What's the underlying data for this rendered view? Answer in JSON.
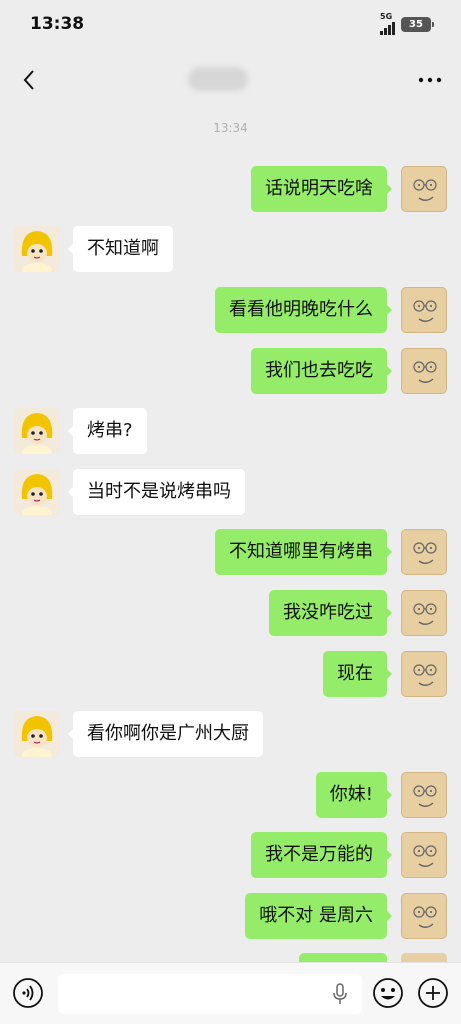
{
  "status": {
    "time": "13:38",
    "network": "5G",
    "battery": "35"
  },
  "chat": {
    "timestamp": "13:34"
  },
  "messages": [
    {
      "side": "right",
      "text": "话说明天吃啥"
    },
    {
      "side": "left",
      "text": "不知道啊"
    },
    {
      "side": "right",
      "text": "看看他明晚吃什么"
    },
    {
      "side": "right",
      "text": "我们也去吃吃"
    },
    {
      "side": "left",
      "text": "烤串?"
    },
    {
      "side": "left",
      "text": "当时不是说烤串吗"
    },
    {
      "side": "right",
      "text": "不知道哪里有烤串"
    },
    {
      "side": "right",
      "text": "我没咋吃过"
    },
    {
      "side": "right",
      "text": "现在"
    },
    {
      "side": "left",
      "text": "看你啊你是广州大厨"
    },
    {
      "side": "right",
      "text": "你妹!"
    },
    {
      "side": "right",
      "text": "我不是万能的"
    },
    {
      "side": "right",
      "text": "哦不对 是周六"
    }
  ],
  "input": {
    "value": "",
    "placeholder": ""
  },
  "icons": {
    "back": "chevron-left-icon",
    "more": "more-dots-icon",
    "voice": "voice-icon",
    "mic": "microphone-icon",
    "emoji": "emoji-icon",
    "plus": "plus-icon"
  },
  "colors": {
    "background": "#ededed",
    "bubble_right": "#95ec69",
    "bubble_left": "#ffffff",
    "timestamp": "#b0b0b0"
  }
}
